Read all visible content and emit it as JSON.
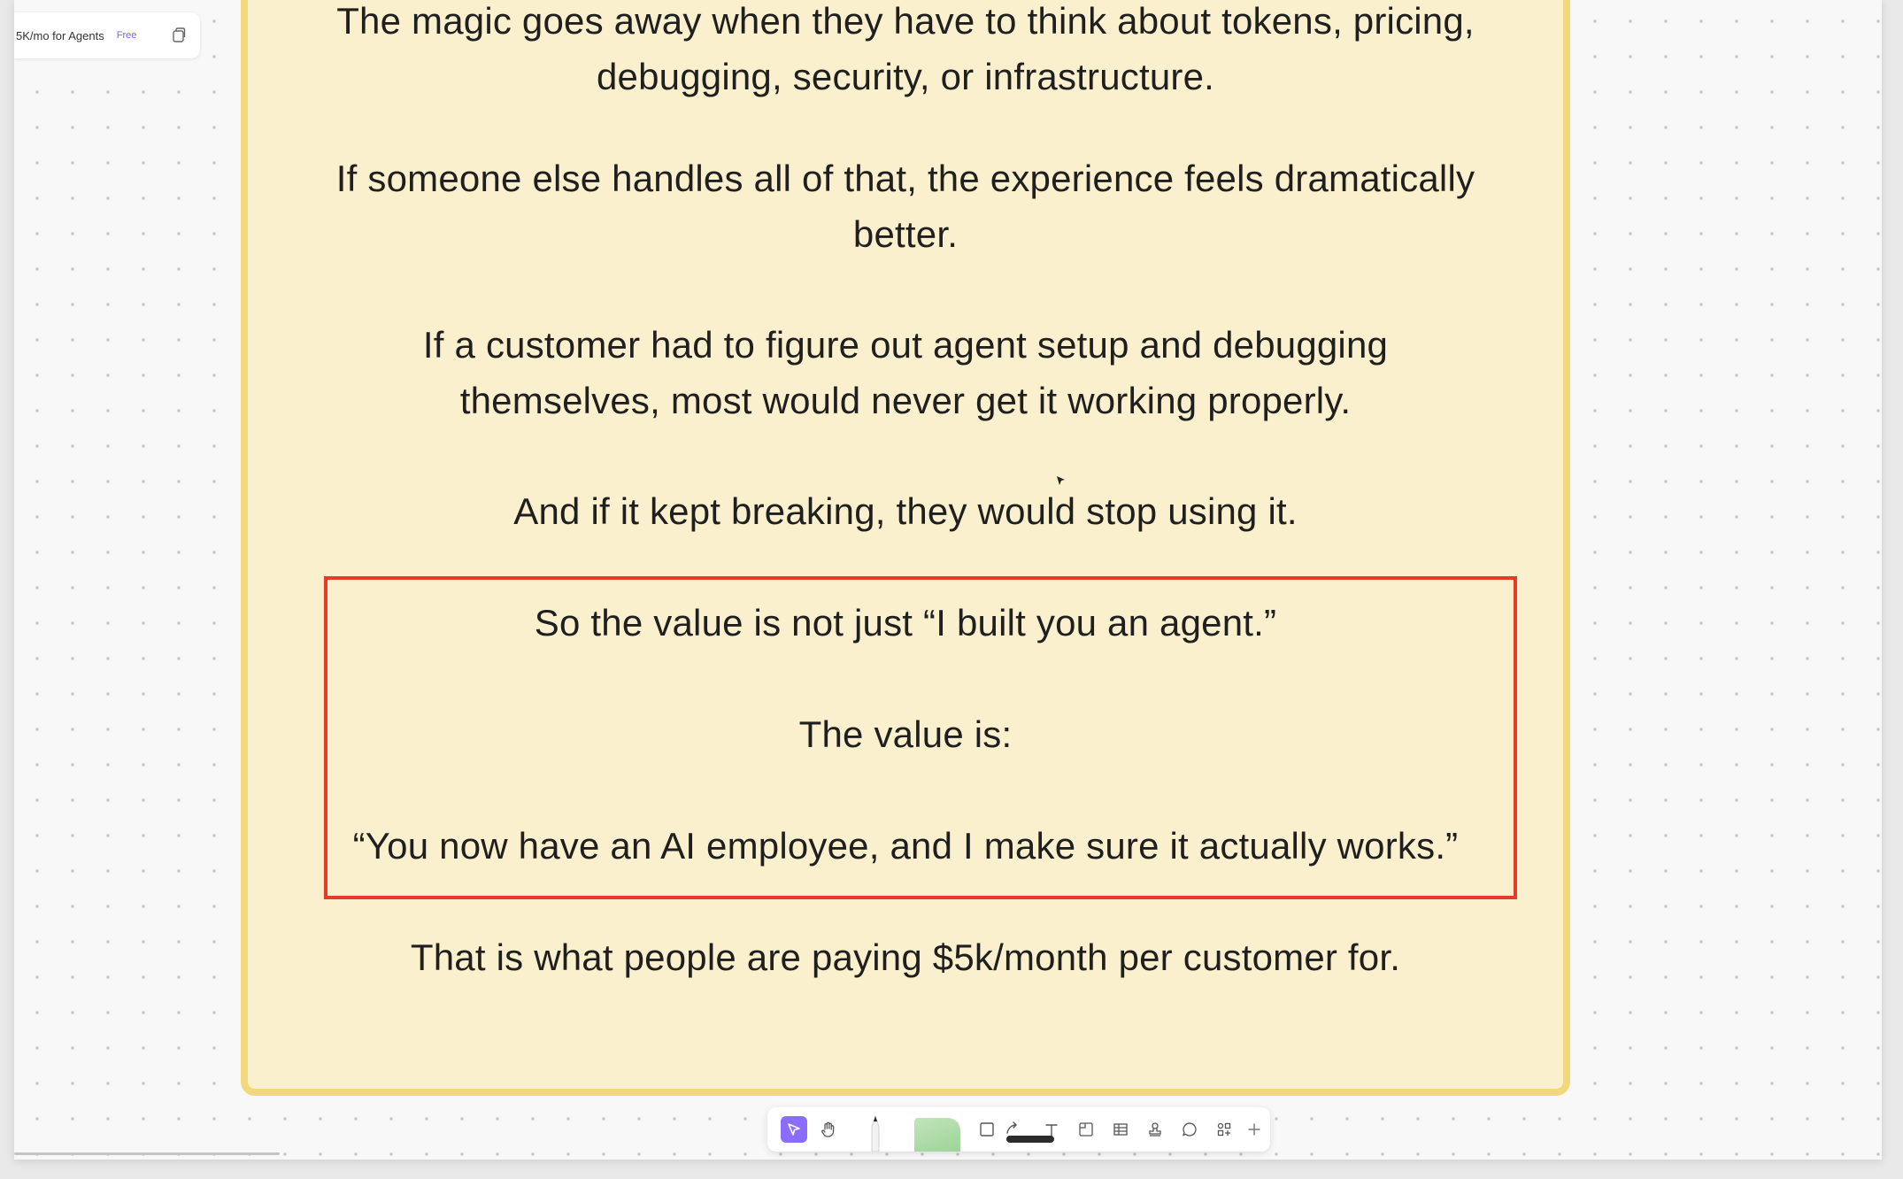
{
  "file_header": {
    "title": "5K/mo for Agents",
    "plan_badge": "Free",
    "copy_icon": "copy-icon"
  },
  "sticky_note": {
    "background_color": "#fbf0cd",
    "border_color": "#f3d77c",
    "paragraphs": [
      "The magic goes away when they have to think about tokens, pricing, debugging, security, or infrastructure.",
      "If someone else handles all of that, the experience feels dramatically better.",
      "If a customer had to figure out agent setup and debugging themselves, most would never get it working properly.",
      "And if it kept breaking, they would stop using it."
    ],
    "highlighted": {
      "border_color": "#e8392b",
      "lines": [
        "So the value is not just “I built you an agent.”",
        "The value is:",
        "“You now have an AI employee, and I make sure it actually works.”"
      ]
    },
    "closing": "That is what people are paying $5k/month per customer for."
  },
  "toolbar": {
    "accent_color": "#8a6cff",
    "tools": [
      "select-tool-icon",
      "hand-tool-icon",
      "marker-pen-icon",
      "sticky-note-icon",
      "shape-square-icon",
      "connector-arrow-icon",
      "text-tool-icon",
      "section-icon",
      "table-icon",
      "stamp-icon",
      "comment-icon",
      "widgets-icon",
      "plus-icon"
    ]
  }
}
